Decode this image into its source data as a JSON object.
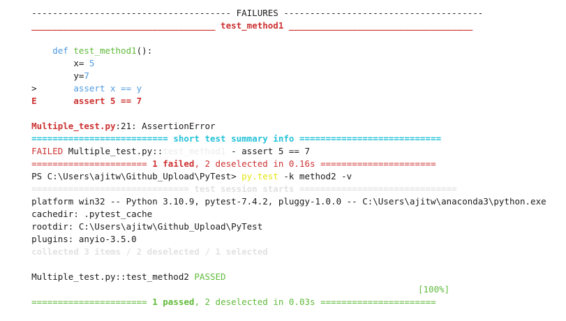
{
  "colors": {
    "red": "#cd3131",
    "cyan": "#25c2d8",
    "green": "#5fba3a",
    "blue": "#3b8eea",
    "yellow": "#e5e510",
    "faint": "#e2e2e2"
  },
  "failures_rule": "-------------------------------------- FAILURES --------------------------------------",
  "section_rule": {
    "left": "___________________________________",
    "title": "test_method1",
    "right": "___________________________________"
  },
  "code": {
    "def_kw": "def",
    "func_name": "test_method1",
    "signature_tail": "():",
    "x_assign": "x= ",
    "x_value": "5",
    "y_assign": "y=",
    "y_value": "7",
    "arrow": ">",
    "assert_line": "assert x == y",
    "e_marker": "E",
    "e_line": "assert 5 == 7"
  },
  "error": {
    "file": "Multiple_test.py",
    "location": ":21: AssertionError"
  },
  "summary_rule": {
    "left": "==========================",
    "title": "short test summary info",
    "right": "==========================="
  },
  "failed_line": {
    "label": "FAILED",
    "path": " Multiple_test.py::",
    "ghost": "test_method1",
    "message": " - assert 5 == 7"
  },
  "result1_rule": {
    "left": "======================",
    "failed": "1 failed",
    "sep": ", ",
    "deselected": "2 deselected in 0.16s",
    "right": "======================"
  },
  "prompt": {
    "path": "PS C:\\Users\\ajitw\\Github_Upload\\PyTest> ",
    "cmd": "py.test",
    "args": " -k method2 -v"
  },
  "session_rule": "============================== test session starts ==============================",
  "session_info": {
    "platform": "platform win32 -- Python 3.10.9, pytest-7.4.2, pluggy-1.0.0 -- C:\\Users\\ajitw\\anaconda3\\python.exe",
    "cachedir": "cachedir: .pytest_cache",
    "rootdir": "rootdir: C:\\Users\\ajitw\\Github_Upload\\PyTest",
    "plugins": "plugins: anyio-3.5.0",
    "collected": "collected 3 items / 2 deselected / 1 selected"
  },
  "test_result": {
    "name": "Multiple_test.py::test_method2 ",
    "status": "PASSED",
    "percent": "[100%]"
  },
  "result2_rule": {
    "left": "======================",
    "passed": "1 passed",
    "sep": ", ",
    "deselected": "2 deselected in 0.03s",
    "right": "======================"
  }
}
